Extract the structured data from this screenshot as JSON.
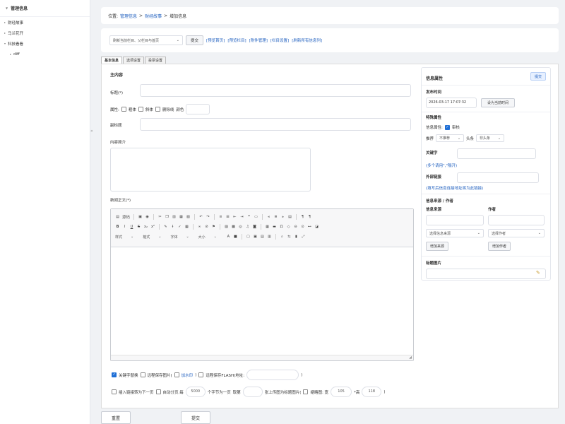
{
  "sidebar": {
    "header": "管理信息",
    "items": [
      {
        "label": "财经故事"
      },
      {
        "label": "马兰花开"
      },
      {
        "label": "科技看看"
      },
      {
        "label": "diff"
      }
    ]
  },
  "breadcrumb": {
    "prefix": "位置:",
    "crumb1": "管理信息",
    "sep1": ">",
    "crumb2": "财经故事",
    "sep2": ">",
    "current": "增加信息"
  },
  "toolbar": {
    "select_value": "刷新当前栏目、父栏目与首页",
    "submit": "提交",
    "links": [
      "[预览首页]",
      "[预览栏目]",
      "[附件管理]",
      "[栏目设置]",
      "[刷新所有信息列]"
    ]
  },
  "tabs": [
    "基本信息",
    "选项设置",
    "投票设置"
  ],
  "form": {
    "section_main": "主内容",
    "title_label": "标题(*)",
    "attr_label": "属性:",
    "attr_bold": "粗体",
    "attr_italic": "斜体",
    "attr_strike": "删除线",
    "attr_color": "颜色",
    "subtitle_label": "副标题",
    "summary_label": "内容简介",
    "content_label": "新闻正文(*)",
    "editor": {
      "source": "源码",
      "format": "格式",
      "fontfamily": "字体",
      "styles": "样式",
      "size": "大小"
    },
    "opt1": "关键字替换",
    "opt2": "远程保存图片(",
    "opt2_link": "加水印",
    "opt2_close": ")",
    "opt3": "远程保存FLASH(地址:",
    "opt3_close": ")",
    "opt4": "插入链接转为下一页",
    "opt5": "自动分页,每",
    "page_chars": "5000",
    "opt5_tail": "个字节为一页",
    "opt6_pre": "取第",
    "opt6": "张上传图为标题图片(",
    "opt7": "缩略图: 宽",
    "thumb_w": "105",
    "thumb_h_label": "*高",
    "thumb_h": "118",
    "opt7_close": ")"
  },
  "side": {
    "title": "信息属性",
    "publish": "提交",
    "pubtime_label": "发布时间",
    "pubtime_value": "2026-03-17 17:07:32",
    "set_time": "设为当前时间",
    "special_label": "特殊属性",
    "info_attr": "信息属性:",
    "audit": "审核",
    "recommend": "推荐",
    "recommend_val": "不推荐",
    "headline": "头条",
    "headline_val": "非头条",
    "keyword_label": "关键字",
    "keyword_hint": "(多个请用\",\"隔开)",
    "link_label": "外部链接",
    "link_hint": "(填写后信息连接地址将为此链接)",
    "source_section": "信息来源 / 作者",
    "source_label": "信息来源",
    "author_label": "作者",
    "source_select": "选择信息来源",
    "author_select": "选择作者",
    "add_source": "增加来源",
    "add_author": "增加作者",
    "thumb_label": "标题图片"
  },
  "footer": {
    "reset": "重置",
    "submit": "提交"
  }
}
